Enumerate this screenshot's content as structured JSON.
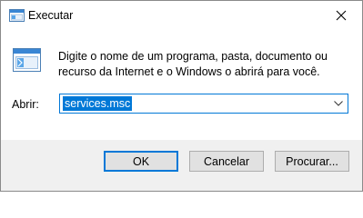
{
  "window": {
    "title": "Executar",
    "title_icon": "run-dialog-icon",
    "close_icon": "close-icon"
  },
  "content": {
    "icon": "run-dialog-icon",
    "description": "Digite o nome de um programa, pasta, documento ou recurso da Internet e o Windows o abrirá para você.",
    "open_label": "Abrir:",
    "open_value": "services.msc",
    "dropdown_icon": "chevron-down-icon"
  },
  "buttons": {
    "ok": "OK",
    "cancel": "Cancelar",
    "browse": "Procurar..."
  },
  "colors": {
    "accent": "#0078d7",
    "footer_bg": "#f0f0f0",
    "button_bg": "#e1e1e1",
    "button_border": "#adadad"
  }
}
